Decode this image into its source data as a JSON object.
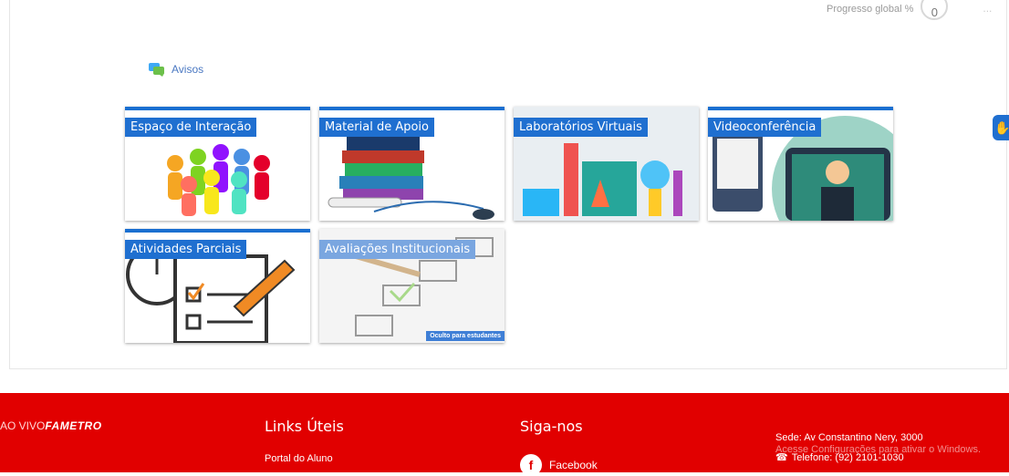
{
  "header": {
    "progress_label": "Progresso global %",
    "progress_value": "0",
    "more": "..."
  },
  "avisos": {
    "label": "Avisos",
    "icon": "chat-bubbles-icon"
  },
  "tiles": [
    {
      "title": "Espaço de Interação"
    },
    {
      "title": "Material de Apoio"
    },
    {
      "title": "Laboratórios Virtuais"
    },
    {
      "title": "Videoconferência"
    },
    {
      "title": "Atividades Parciais"
    },
    {
      "title": "Avaliações Institucionais",
      "badge": "Oculto para estudantes"
    }
  ],
  "accessibility": {
    "icon": "accessibility-hand-icon"
  },
  "footer": {
    "brand_prefix": "AO VIVO",
    "brand_name": "FAMETRO",
    "links_title": "Links Úteis",
    "links": [
      "Portal do Aluno"
    ],
    "social_title": "Siga-nos",
    "facebook": "Facebook",
    "address": "Sede: Av Constantino Nery, 3000",
    "phone": "Telefone: (92) 2101-1030",
    "windows_watermark": "Acesse Configurações para ativar o Windows."
  },
  "colors": {
    "footer_red": "#e10000",
    "tile_blue": "#1f6fd0",
    "link_blue": "#4a78c2"
  }
}
